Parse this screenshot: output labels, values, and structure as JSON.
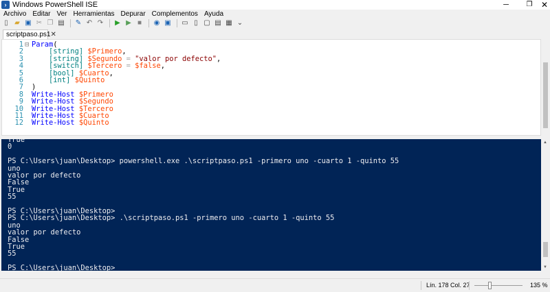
{
  "window": {
    "title": "Windows PowerShell ISE",
    "minimize": "─",
    "maximize": "❐",
    "close": "✕"
  },
  "menu": [
    "Archivo",
    "Editar",
    "Ver",
    "Herramientas",
    "Depurar",
    "Complementos",
    "Ayuda"
  ],
  "toolbar": {
    "items": [
      {
        "name": "new-file-icon",
        "glyph": "▯",
        "color": "#555555"
      },
      {
        "name": "open-file-icon",
        "glyph": "▰",
        "color": "#d8a630"
      },
      {
        "name": "save-icon",
        "glyph": "▣",
        "color": "#1c64b4"
      },
      {
        "name": "cut-icon",
        "glyph": "✂",
        "color": "#999999"
      },
      {
        "name": "copy-icon",
        "glyph": "❐",
        "color": "#999999"
      },
      {
        "name": "paste-icon",
        "glyph": "▤",
        "color": "#444444"
      },
      {
        "name": "clear-console-icon",
        "glyph": "✎",
        "color": "#1c64b4"
      },
      {
        "name": "undo-icon",
        "glyph": "↶",
        "color": "#666666"
      },
      {
        "name": "redo-icon",
        "glyph": "↷",
        "color": "#666666"
      },
      {
        "name": "run-script-icon",
        "glyph": "▶",
        "color": "#2aa02a"
      },
      {
        "name": "run-selection-icon",
        "glyph": "▶",
        "color": "#5aa05a"
      },
      {
        "name": "stop-icon",
        "glyph": "■",
        "color": "#808080"
      },
      {
        "name": "remote-powershell-icon",
        "glyph": "◉",
        "color": "#1c64b4"
      },
      {
        "name": "start-powershell-icon",
        "glyph": "▣",
        "color": "#1c64b4"
      },
      {
        "name": "show-script-top-icon",
        "glyph": "▭",
        "color": "#444444"
      },
      {
        "name": "show-script-right-icon",
        "glyph": "▯",
        "color": "#444444"
      },
      {
        "name": "show-script-maximized-icon",
        "glyph": "▢",
        "color": "#444444"
      },
      {
        "name": "show-command-window-icon",
        "glyph": "▤",
        "color": "#444444"
      },
      {
        "name": "show-command-addon-icon",
        "glyph": "▦",
        "color": "#444444"
      },
      {
        "name": "toolbar-overflow-icon",
        "glyph": "⌄",
        "color": "#444444"
      }
    ]
  },
  "tab": {
    "label": "scriptpaso.ps1",
    "close": "✕"
  },
  "editor": {
    "lines": [
      {
        "n": "1",
        "fold": "⊟",
        "tokens": [
          {
            "t": "Param",
            "c": "kw"
          },
          {
            "t": "(",
            "c": "plain"
          }
        ]
      },
      {
        "n": "2",
        "fold": "",
        "tokens": [
          {
            "t": "    ",
            "c": "plain"
          },
          {
            "t": "[string]",
            "c": "type"
          },
          {
            "t": " ",
            "c": "plain"
          },
          {
            "t": "$Primero",
            "c": "var"
          },
          {
            "t": ",",
            "c": "plain"
          }
        ]
      },
      {
        "n": "3",
        "fold": "",
        "tokens": [
          {
            "t": "    ",
            "c": "plain"
          },
          {
            "t": "[string]",
            "c": "type"
          },
          {
            "t": " ",
            "c": "plain"
          },
          {
            "t": "$Segundo",
            "c": "var"
          },
          {
            "t": " = ",
            "c": "op"
          },
          {
            "t": "\"valor por defecto\"",
            "c": "str"
          },
          {
            "t": ",",
            "c": "plain"
          }
        ]
      },
      {
        "n": "4",
        "fold": "",
        "tokens": [
          {
            "t": "    ",
            "c": "plain"
          },
          {
            "t": "[switch]",
            "c": "type"
          },
          {
            "t": " ",
            "c": "plain"
          },
          {
            "t": "$Tercero",
            "c": "var"
          },
          {
            "t": " = ",
            "c": "op"
          },
          {
            "t": "$false",
            "c": "var"
          },
          {
            "t": ",",
            "c": "plain"
          }
        ]
      },
      {
        "n": "5",
        "fold": "",
        "tokens": [
          {
            "t": "    ",
            "c": "plain"
          },
          {
            "t": "[bool]",
            "c": "type"
          },
          {
            "t": " ",
            "c": "plain"
          },
          {
            "t": "$Cuarto",
            "c": "var"
          },
          {
            "t": ",",
            "c": "plain"
          }
        ]
      },
      {
        "n": "6",
        "fold": "",
        "tokens": [
          {
            "t": "    ",
            "c": "plain"
          },
          {
            "t": "[int]",
            "c": "type"
          },
          {
            "t": " ",
            "c": "plain"
          },
          {
            "t": "$Quinto",
            "c": "var"
          }
        ]
      },
      {
        "n": "7",
        "fold": "",
        "tokens": [
          {
            "t": ")",
            "c": "plain"
          }
        ]
      },
      {
        "n": "8",
        "fold": "",
        "tokens": [
          {
            "t": "Write-Host",
            "c": "cmd"
          },
          {
            "t": " ",
            "c": "plain"
          },
          {
            "t": "$Primero",
            "c": "var"
          }
        ]
      },
      {
        "n": "9",
        "fold": "",
        "tokens": [
          {
            "t": "Write-Host",
            "c": "cmd"
          },
          {
            "t": " ",
            "c": "plain"
          },
          {
            "t": "$Segundo",
            "c": "var"
          }
        ]
      },
      {
        "n": "10",
        "fold": "",
        "tokens": [
          {
            "t": "Write-Host",
            "c": "cmd"
          },
          {
            "t": " ",
            "c": "plain"
          },
          {
            "t": "$Tercero",
            "c": "var"
          }
        ]
      },
      {
        "n": "11",
        "fold": "",
        "tokens": [
          {
            "t": "Write-Host",
            "c": "cmd"
          },
          {
            "t": " ",
            "c": "plain"
          },
          {
            "t": "$Cuarto",
            "c": "var"
          }
        ]
      },
      {
        "n": "12",
        "fold": "",
        "tokens": [
          {
            "t": "Write-Host",
            "c": "cmd"
          },
          {
            "t": " ",
            "c": "plain"
          },
          {
            "t": "$Quinto",
            "c": "var"
          }
        ]
      }
    ]
  },
  "console": {
    "lines": [
      "True",
      "0",
      "",
      "PS C:\\Users\\juan\\Desktop> powershell.exe .\\scriptpaso.ps1 -primero uno -cuarto 1 -quinto 55",
      "uno",
      "valor por defecto",
      "False",
      "True",
      "55",
      "",
      "PS C:\\Users\\juan\\Desktop>",
      "PS C:\\Users\\juan\\Desktop> .\\scriptpaso.ps1 -primero uno -cuarto 1 -quinto 55",
      "uno",
      "valor por defecto",
      "False",
      "True",
      "55",
      "",
      "PS C:\\Users\\juan\\Desktop>"
    ]
  },
  "status": {
    "position": "Lín. 178  Col. 27",
    "zoom": "135 %",
    "zoom_level_percent": 135
  }
}
